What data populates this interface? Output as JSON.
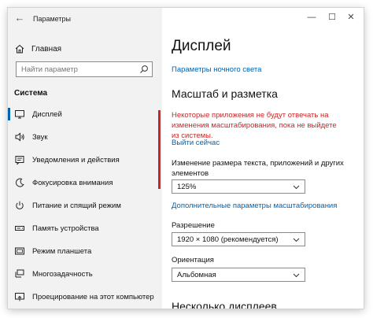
{
  "window": {
    "title": "Параметры",
    "back_icon": "back-arrow-icon",
    "controls": {
      "minimize": "—",
      "maximize": "☐",
      "close": "✕"
    }
  },
  "sidebar": {
    "home_label": "Главная",
    "search_placeholder": "Найти параметр",
    "section_title": "Система",
    "items": [
      {
        "label": "Дисплей",
        "icon": "display-icon",
        "selected": true
      },
      {
        "label": "Звук",
        "icon": "sound-icon"
      },
      {
        "label": "Уведомления и действия",
        "icon": "notifications-icon"
      },
      {
        "label": "Фокусировка внимания",
        "icon": "focus-assist-icon"
      },
      {
        "label": "Питание и спящий режим",
        "icon": "power-icon"
      },
      {
        "label": "Память устройства",
        "icon": "storage-icon"
      },
      {
        "label": "Режим планшета",
        "icon": "tablet-mode-icon"
      },
      {
        "label": "Многозадачность",
        "icon": "multitasking-icon"
      },
      {
        "label": "Проецирование на этот компьютер",
        "icon": "projecting-icon"
      }
    ]
  },
  "main": {
    "title": "Дисплей",
    "night_light_link": "Параметры ночного света",
    "scale_heading": "Масштаб и разметка",
    "warning_text": "Некоторые приложения не будут отвечать на изменения масштабирования, пока не выйдете из системы.",
    "signout_link": "Выйти сейчас",
    "text_size_label": "Изменение размера текста, приложений и других элементов",
    "text_size_value": "125%",
    "advanced_scaling_link": "Дополнительные параметры масштабирования",
    "resolution_label": "Разрешение",
    "resolution_value": "1920 × 1080 (рекомендуется)",
    "orientation_label": "Ориентация",
    "orientation_value": "Альбомная",
    "multiple_displays_heading": "Несколько дисплеев"
  },
  "colors": {
    "accent": "#0063b1",
    "warning": "#c62828",
    "sidebar_bg": "#f2f2f2"
  }
}
